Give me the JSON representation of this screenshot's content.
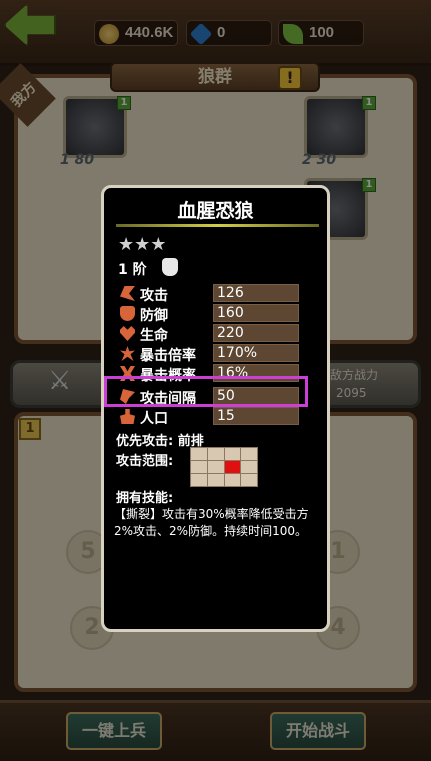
{
  "header": {
    "gold": "440.6K",
    "gems": "0",
    "leaves": "100",
    "title": "狼群",
    "side_label": "我方"
  },
  "board": {
    "units": [
      {
        "level": "1 80"
      },
      {
        "level": "2 30"
      }
    ],
    "enemy_power_label": "敌方战力",
    "enemy_power_value": "2095",
    "slot_number": "1",
    "slots": [
      "5",
      "2",
      "1",
      "4"
    ]
  },
  "buttons": {
    "auto_deploy": "一键上兵",
    "start_battle": "开始战斗"
  },
  "popup": {
    "title": "血腥恐狼",
    "stars": "★★★",
    "tier": "1 阶",
    "stats": [
      {
        "label": "攻击",
        "value": "126"
      },
      {
        "label": "防御",
        "value": "160"
      },
      {
        "label": "生命",
        "value": "220"
      },
      {
        "label": "暴击倍率",
        "value": "170%"
      },
      {
        "label": "暴击概率",
        "value": "16%"
      },
      {
        "label": "攻击间隔",
        "value": "50"
      },
      {
        "label": "人口",
        "value": "15"
      }
    ],
    "priority_attack": "优先攻击: 前排",
    "attack_range_label": "攻击范围:",
    "range_grid": [
      [
        0,
        0,
        0,
        0
      ],
      [
        0,
        0,
        1,
        0
      ],
      [
        0,
        0,
        0,
        0
      ]
    ],
    "skills_label": "拥有技能:",
    "skill_text": "【撕裂】攻击有30%概率降低受击方2%攻击、2%防御。持续时间100。"
  },
  "colors": {
    "highlight": "#cc3fd4",
    "stat_bar": "#5d4632",
    "range_active": "#e01010"
  }
}
